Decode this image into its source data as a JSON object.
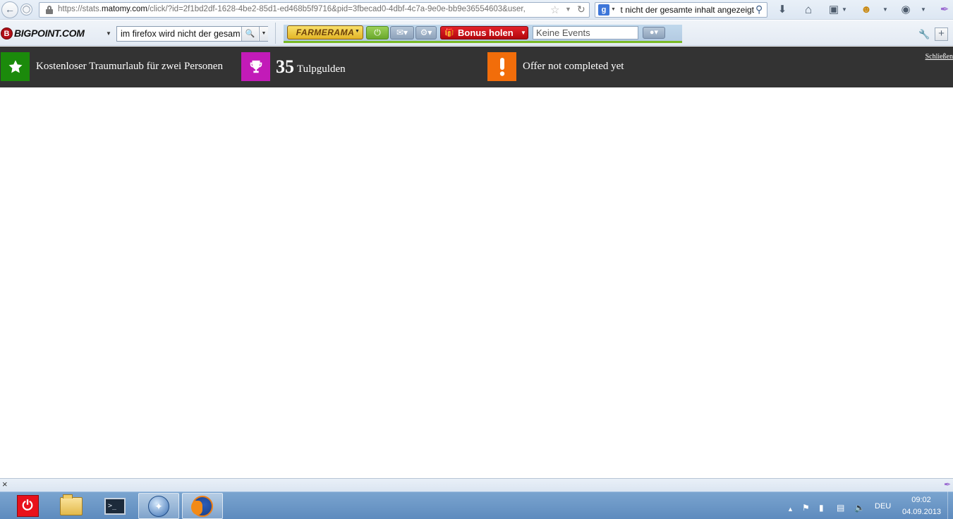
{
  "browser": {
    "url_prefix": "https://stats.",
    "url_domain": "matomy.com",
    "url_rest": "/click/?id=2f1bd2df-1628-4be2-85d1-ed468b5f9716&pid=3fbecad0-4dbf-4c7a-9e0e-bb9e36554603&user,",
    "search_engine_letter": "g",
    "search_value": "t nicht der gesamte inhalt angezeigt"
  },
  "bigpoint_toolbar": {
    "logo_letter": "B",
    "logo_text": "BIGPOINT.COM",
    "search_value": "im firefox wird nicht der gesamte inhalt angezeigt",
    "game_logo": "FARMERAMA",
    "bonus_label": "Bonus holen",
    "events_placeholder": "Keine Events"
  },
  "offer_banner": {
    "offer_title": "Kostenloser Traumurlaub für zwei Personen",
    "reward_amount": "35",
    "reward_currency": "Tulpgulden",
    "status_text": "Offer not completed yet",
    "close_label": "Schließen",
    "colors": {
      "background": "#333333",
      "offer_badge": "#1b8a0b",
      "reward_badge": "#c21bb8",
      "status_badge": "#f26d0a"
    }
  },
  "taskbar": {
    "language": "DEU",
    "time": "09:02",
    "date": "04.09.2013",
    "apps": [
      "power-icon",
      "folder-icon",
      "console-icon",
      "thunderbird-icon",
      "firefox-icon"
    ]
  }
}
